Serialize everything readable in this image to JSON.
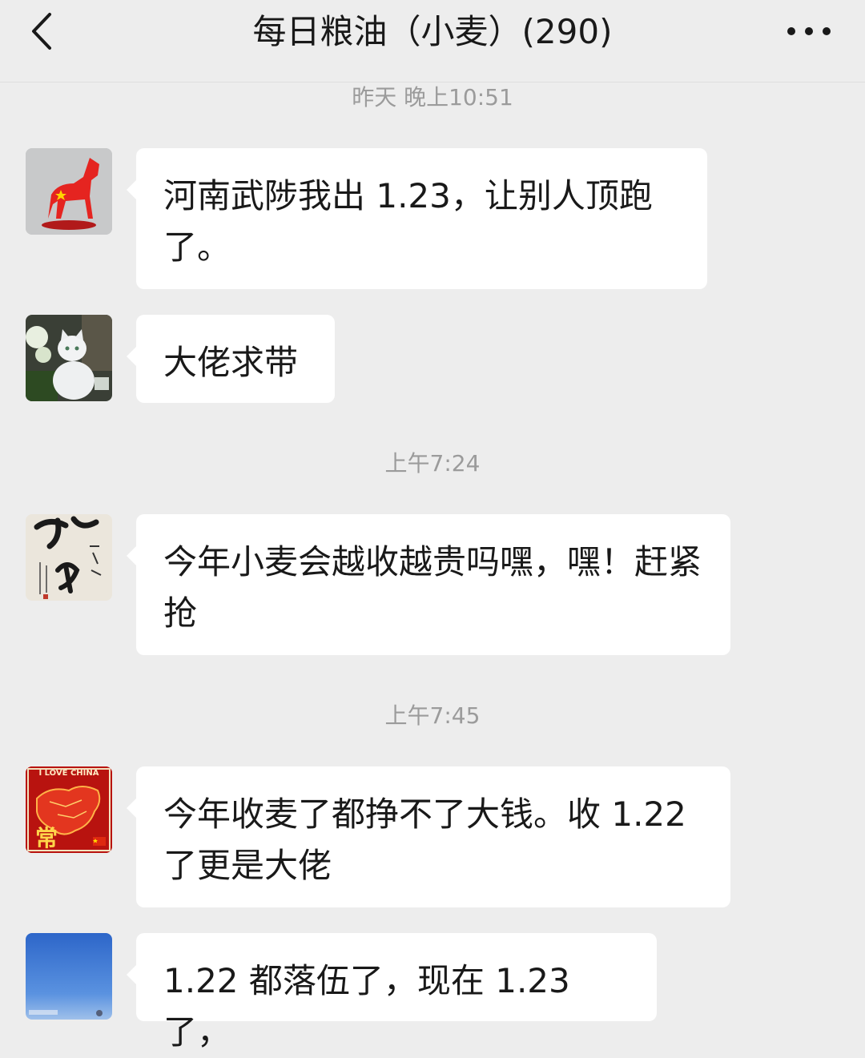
{
  "header": {
    "back_icon": "chevron-left-icon",
    "title": "每日粮油（小麦）(290)",
    "more_icon": "more-dots-icon"
  },
  "messages": [
    {
      "time": "昨天 晚上10:51",
      "avatar": "red-horse-avatar",
      "text": "河南武陟我出 1.23，让别人顶跑了。"
    },
    {
      "avatar": "white-cat-avatar",
      "text": "大佬求带"
    },
    {
      "time": "上午7:24",
      "avatar": "calligraphy-avatar",
      "text": "今年小麦会越收越贵吗嘿，嘿！赶紧抢"
    },
    {
      "time": "上午7:45",
      "avatar": "love-china-avatar",
      "avatar_text": "I LOVE CHINA",
      "avatar_char": "常",
      "text": "今年收麦了都挣不了大钱。收 1.22 了更是大佬"
    },
    {
      "avatar": "blue-sky-avatar",
      "text": "1.22 都落伍了，现在 1.23 了，"
    }
  ]
}
